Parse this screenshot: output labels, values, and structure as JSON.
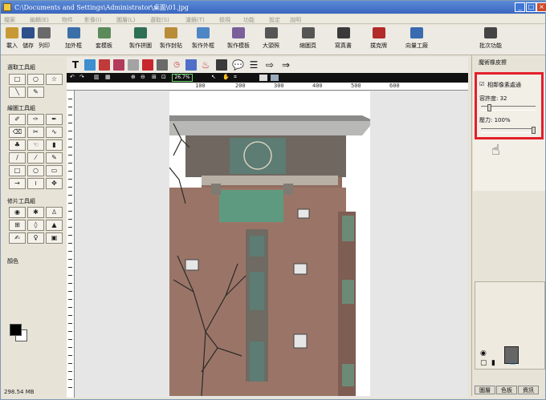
{
  "window": {
    "title": "C:\\Documents and Settings\\Administrator\\桌面\\01.jpg",
    "min": "_",
    "max": "□",
    "close": "×"
  },
  "menu": [
    "檔案",
    "編輯(E)",
    "物件",
    "影像(I)",
    "圖層(L)",
    "選取(S)",
    "濾鏡(T)",
    "檢視",
    "功能",
    "設定",
    "說明"
  ],
  "toolbar": [
    {
      "label": "載入",
      "icon": "open-folder-icon",
      "color": "#c89a35"
    },
    {
      "label": "儲存",
      "icon": "save-disk-icon",
      "color": "#2e4f8a"
    },
    {
      "label": "列印",
      "icon": "printer-icon",
      "color": "#6a6a6a"
    },
    {
      "label": "加外框",
      "icon": "frame-icon",
      "color": "#3b6fa8"
    },
    {
      "label": "套模板",
      "icon": "template-icon",
      "color": "#5b8a5b"
    },
    {
      "label": "製作拼圖",
      "icon": "puzzle-icon",
      "color": "#2e6f56"
    },
    {
      "label": "製作封貼",
      "icon": "sticker-icon",
      "color": "#b98c3a"
    },
    {
      "label": "製作外框",
      "icon": "outer-frame-icon",
      "color": "#4d86c5"
    },
    {
      "label": "製作模板",
      "icon": "make-template-icon",
      "color": "#7a5f9a"
    },
    {
      "label": "大頭照",
      "icon": "portrait-grid-icon",
      "color": "#555555"
    },
    {
      "label": "縮圖頁",
      "icon": "thumbnail-page-icon",
      "color": "#555555"
    },
    {
      "label": "寫真書",
      "icon": "photobook-icon",
      "color": "#3a3a3a"
    },
    {
      "label": "撲克牌",
      "icon": "poker-cards-icon",
      "color": "#b22a2a"
    },
    {
      "label": "向量工廠",
      "icon": "vector-factory-icon",
      "color": "#3a6ab0"
    },
    {
      "label": "批次功能",
      "icon": "batch-icon",
      "color": "#444444"
    }
  ],
  "left": {
    "select_group": "選取工具組",
    "paint_group": "繪圖工具組",
    "repair_group": "修片工具組",
    "color_label": "顏色",
    "colors": {
      "foreground": "#000000",
      "background": "#ffffff"
    }
  },
  "status": {
    "memory": "298.54 MB"
  },
  "ctrl": {
    "zoom": "26.7%"
  },
  "ruler": {
    "marks": [
      "100",
      "200",
      "300",
      "400",
      "500",
      "600"
    ]
  },
  "right": {
    "title": "魔術橡皮擦",
    "checkbox": "相鄰像素處通",
    "tolerance_label": "容許度: 32",
    "tolerance": 32,
    "pressure_label": "壓力: 100%",
    "pressure": 100,
    "tabs": [
      "圖層",
      "色板",
      "資訊"
    ]
  }
}
